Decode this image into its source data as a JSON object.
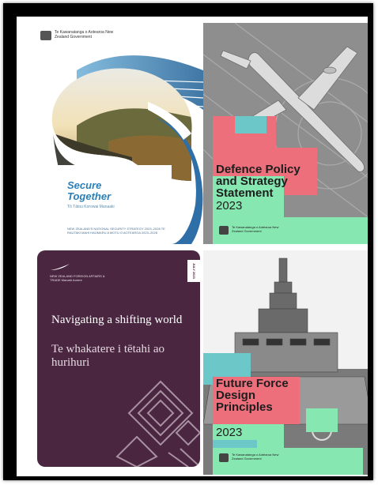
{
  "covers": [
    {
      "logo_text": "Te Kawanatanga o Aotearoa New Zealand Government",
      "title_line1": "Secure",
      "title_line2": "Together",
      "subtitle": "Tō Tātou Korowai Manaaki",
      "fine_print": "NEW ZEALAND'S NATIONAL SECURITY STRATEGY 2023–2028 TE RAUTAKI MAHI HAUMARU A MOTU O AOTEAROA 2023–2028"
    },
    {
      "title": "Defence Policy and Strategy Statement",
      "year": "2023",
      "logo_text": "Te Kawanatanga o Aotearoa New Zealand Government"
    },
    {
      "badge": "JULY 2023",
      "logo_text": "NEW ZEALAND FOREIGN AFFAIRS & TRADE Manatū Aorere",
      "title_en": "Navigating a shifting world",
      "title_mi": "Te whakatere i tētahi ao hurihuri"
    },
    {
      "title": "Future Force Design Principles",
      "year": "2023",
      "logo_text": "Te Kawanatanga o Aotearoa New Zealand Government"
    }
  ],
  "colors": {
    "pink": "#ee6f7c",
    "green": "#86e8b0",
    "teal": "#6cc8c8",
    "plum": "#4a2640",
    "blue": "#2a7fb8"
  }
}
